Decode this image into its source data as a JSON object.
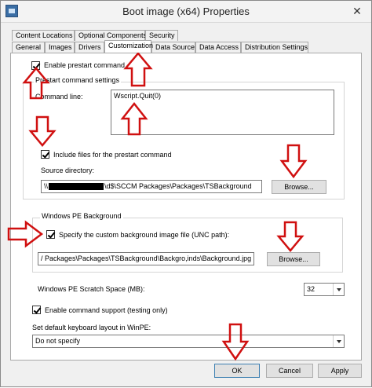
{
  "window": {
    "title": "Boot image (x64) Properties",
    "close_glyph": "✕",
    "app_icon": "window-icon"
  },
  "tabs_row1": [
    "Content Locations",
    "Optional Components",
    "Security"
  ],
  "tabs_row2": [
    "General",
    "Images",
    "Drivers",
    "Customization",
    "Data Source",
    "Data Access",
    "Distribution Settings"
  ],
  "active_tab": "Customization",
  "prestart": {
    "enable_label": "Enable prestart command",
    "enable_checked": true,
    "group_label": "Prestart command settings",
    "command_line_label": "Command line:",
    "command_line_value": "Wscript.Quit(0)",
    "include_files_label": "Include files for the prestart command",
    "include_files_checked": true,
    "source_dir_label": "Source directory:",
    "source_dir_prefix": "\\\\",
    "source_dir_suffix": "\\d$\\SCCM Packages\\Packages\\TSBackground",
    "browse_label": "Browse..."
  },
  "winpe_bg": {
    "group_label": "Windows PE Background",
    "custom_label": "Specify the custom background image file (UNC path):",
    "custom_checked": true,
    "path_value": "/ Packages\\Packages\\TSBackground\\Backgro,inds\\Background.jpg",
    "browse_label": "Browse..."
  },
  "scratch": {
    "label": "Windows PE Scratch Space (MB):",
    "value": "32"
  },
  "command_support": {
    "label": "Enable command support (testing only)",
    "checked": true
  },
  "keyboard": {
    "label": "Set default keyboard layout in WinPE:",
    "value": "Do not specify"
  },
  "footer": {
    "ok": "OK",
    "cancel": "Cancel",
    "apply": "Apply"
  },
  "colors": {
    "annotation_red": "#d01010",
    "accent": "#3c7fb1"
  }
}
